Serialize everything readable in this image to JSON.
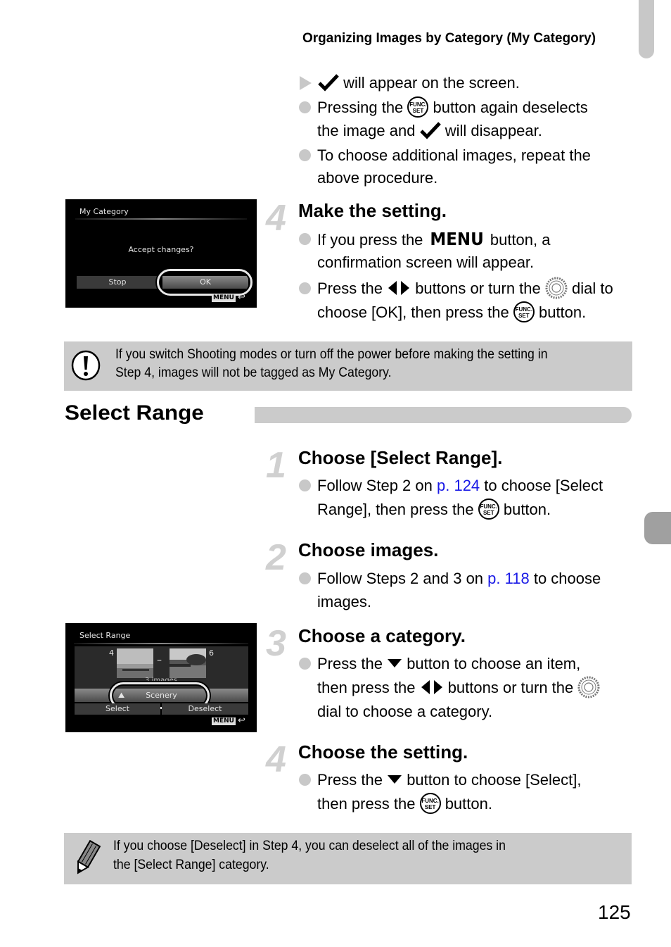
{
  "header": {
    "title": "Organizing Images by Category (My Category)"
  },
  "intro": {
    "result_line": {
      "text": "will appear on the screen.",
      "icon": "checkmark-icon"
    },
    "bullets": [
      {
        "parts": [
          "Pressing the",
          "button again deselects"
        ],
        "line2_parts": [
          "the image and",
          "will disappear."
        ]
      },
      {
        "line1": "To choose additional images, repeat the",
        "line2": "above procedure."
      }
    ]
  },
  "step4_make": {
    "number": "4",
    "title": "Make the setting.",
    "bullet1": {
      "before": "If you press the",
      "menu": "MENU",
      "after": "button, a",
      "line2": "confirmation screen will appear."
    },
    "bullet2": {
      "p1": "Press the",
      "p2": "buttons or turn the",
      "p3": "dial to",
      "line2_a": "choose [OK], then press the",
      "line2_b": "button."
    },
    "screen": {
      "title": "My Category",
      "prompt": "Accept changes?",
      "buttons": [
        "Stop",
        "OK"
      ],
      "selected": "OK",
      "menu_label": "MENU"
    }
  },
  "caution": {
    "icon": "caution-icon",
    "line1": "If you switch Shooting modes or turn off the power before making the setting in",
    "line2": "Step 4, images will not be tagged as My Category."
  },
  "section": {
    "title": "Select Range"
  },
  "steps": [
    {
      "number": "1",
      "title": "Choose [Select Range].",
      "l1_a": "Follow Step 2 on",
      "l1_link": "p. 124",
      "l1_b": "to choose [Select",
      "l2_a": "Range], then press the",
      "l2_b": "button."
    },
    {
      "number": "2",
      "title": "Choose images.",
      "l1_a": "Follow Steps 2 and 3 on",
      "l1_link": "p. 118",
      "l1_b": "to choose",
      "l2": "images."
    },
    {
      "number": "3",
      "title": "Choose a category.",
      "l1_a": "Press the",
      "l1_b": "button to choose an item,",
      "l2_a": "then press the",
      "l2_b": "buttons or turn the",
      "l3": "dial to choose a category."
    },
    {
      "number": "4",
      "title": "Choose the setting.",
      "l1_a": "Press the",
      "l1_b": "button to choose [Select],",
      "l2_a": "then press the",
      "l2_b": "button."
    }
  ],
  "range_screen": {
    "title": "Select Range",
    "start_index": "4",
    "end_index": "6",
    "dash": "–",
    "count_label": "3 images",
    "category": "Scenery",
    "buttons": [
      "Select",
      "Deselect"
    ],
    "menu_label": "MENU"
  },
  "memo": {
    "icon": "pencil-icon",
    "line1": "If you choose [Deselect] in Step 4, you can deselect all of the images in",
    "line2": "the [Select Range] category."
  },
  "icons": {
    "func_set_top": "FUNC.",
    "func_set_bottom": "SET"
  },
  "page_number": "125"
}
